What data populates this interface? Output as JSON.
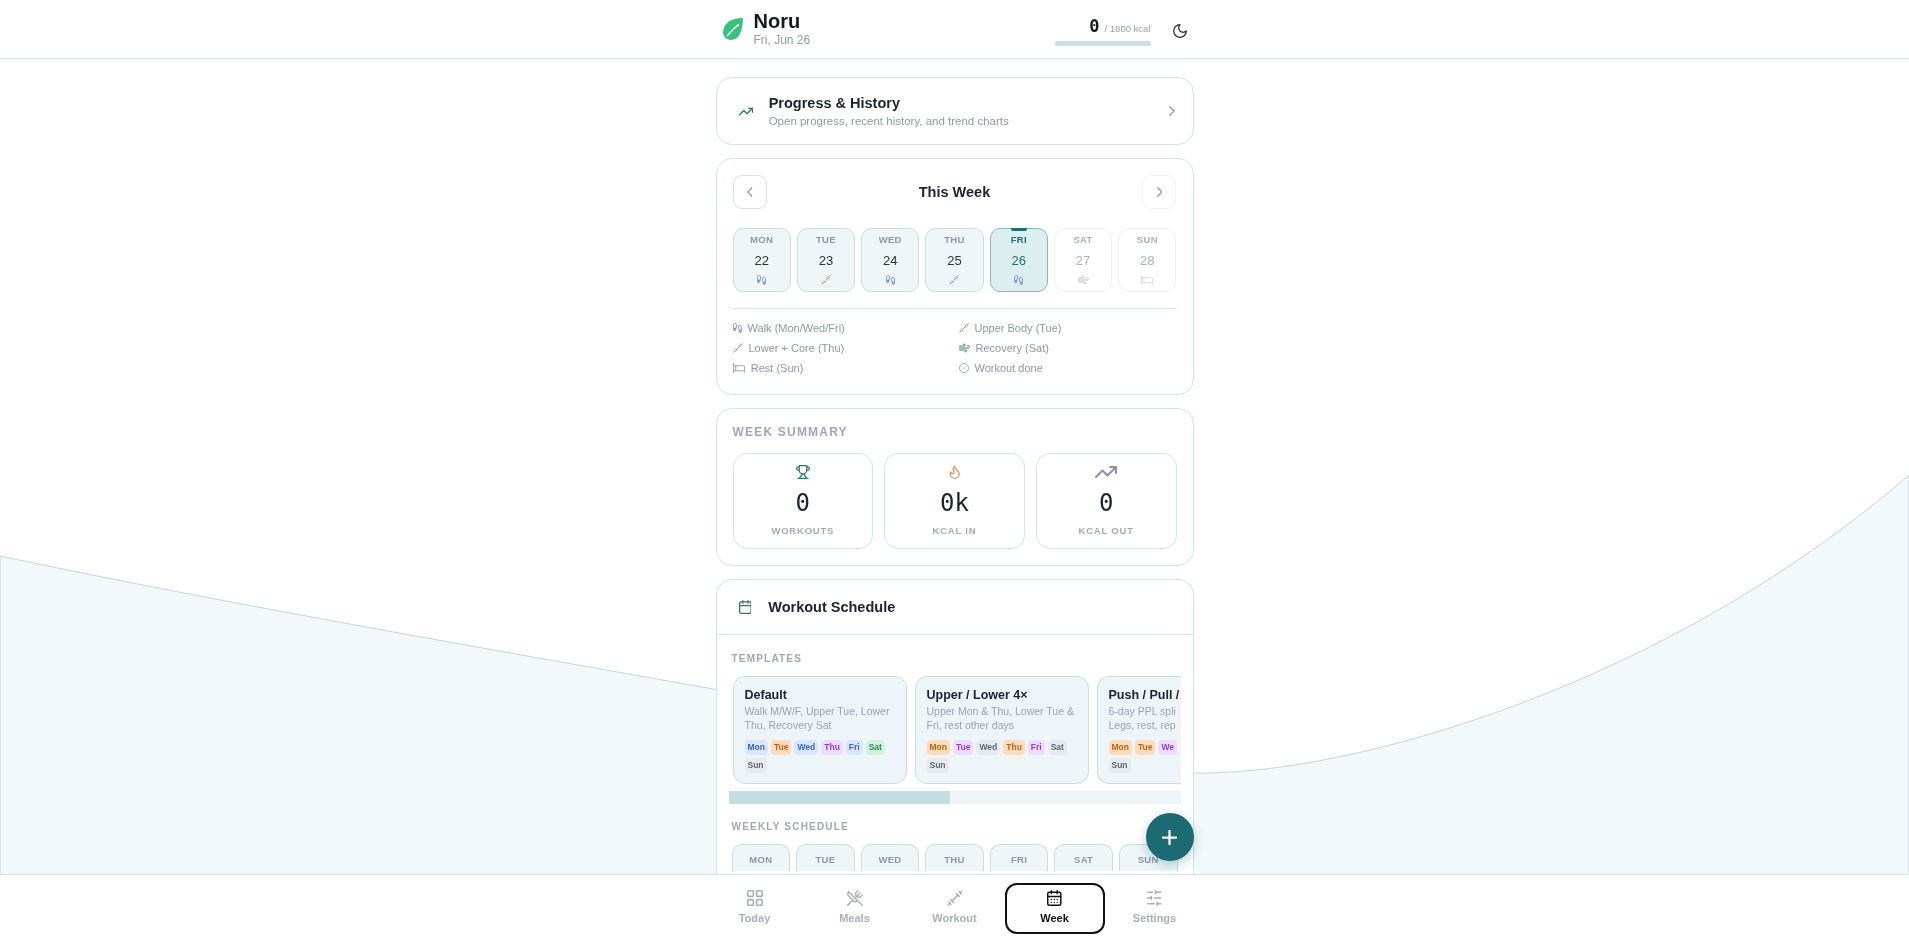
{
  "header": {
    "app_name": "Noru",
    "date": "Fri, Jun 26",
    "calories": {
      "value": "0",
      "goal": "/ 1800 kcal",
      "level": 0
    }
  },
  "progress_card": {
    "title": "Progress & History",
    "subtitle": "Open progress, recent history, and trend charts"
  },
  "week": {
    "title": "This Week",
    "prev": {
      "disabled": false
    },
    "next": {
      "disabled": true
    },
    "days": [
      {
        "name": "MON",
        "date": "22",
        "kind": "walk",
        "selected": false,
        "disabled": false
      },
      {
        "name": "TUE",
        "date": "23",
        "kind": "upper",
        "selected": false,
        "disabled": false
      },
      {
        "name": "WED",
        "date": "24",
        "kind": "walk",
        "selected": false,
        "disabled": false
      },
      {
        "name": "THU",
        "date": "25",
        "kind": "lower",
        "selected": false,
        "disabled": false
      },
      {
        "name": "FRI",
        "date": "26",
        "kind": "walk",
        "selected": true,
        "disabled": false
      },
      {
        "name": "SAT",
        "date": "27",
        "kind": "recovery",
        "selected": false,
        "disabled": true
      },
      {
        "name": "SUN",
        "date": "28",
        "kind": "rest",
        "selected": false,
        "disabled": true
      }
    ],
    "legend": [
      {
        "kind": "walk",
        "label": "Walk (Mon/Wed/Fri)"
      },
      {
        "kind": "upper",
        "label": "Upper Body (Tue)"
      },
      {
        "kind": "lower",
        "label": "Lower + Core (Thu)"
      },
      {
        "kind": "recovery",
        "label": "Recovery (Sat)"
      },
      {
        "kind": "rest",
        "label": "Rest (Sun)"
      },
      {
        "kind": "done",
        "label": "Workout done"
      }
    ]
  },
  "summary": {
    "title": "WEEK SUMMARY",
    "stats": [
      {
        "kind": "workouts",
        "value": "0",
        "label": "WORKOUTS"
      },
      {
        "kind": "kcal_in",
        "value": "0k",
        "label": "KCAL IN"
      },
      {
        "kind": "kcal_out",
        "value": "0",
        "label": "KCAL OUT"
      }
    ]
  },
  "schedule": {
    "title": "Workout Schedule",
    "templates_label": "TEMPLATES",
    "templates": [
      {
        "name": "Default",
        "description": "Walk M/W/F, Upper Tue, Lower\nThu, Recovery Sat",
        "days": [
          {
            "label": "Mon",
            "kind": "walk"
          },
          {
            "label": "Tue",
            "kind": "upper"
          },
          {
            "label": "Wed",
            "kind": "walk"
          },
          {
            "label": "Thu",
            "kind": "lower"
          },
          {
            "label": "Fri",
            "kind": "walk"
          },
          {
            "label": "Sat",
            "kind": "recovery"
          },
          {
            "label": "Sun",
            "kind": "rest"
          }
        ]
      },
      {
        "name": "Upper / Lower 4×",
        "description": "Upper Mon & Thu, Lower Tue &\nFri, rest other days",
        "days": [
          {
            "label": "Mon",
            "kind": "upper"
          },
          {
            "label": "Tue",
            "kind": "lower"
          },
          {
            "label": "Wed",
            "kind": "rest"
          },
          {
            "label": "Thu",
            "kind": "upper"
          },
          {
            "label": "Fri",
            "kind": "lower"
          },
          {
            "label": "Sat",
            "kind": "rest"
          },
          {
            "label": "Sun",
            "kind": "rest"
          }
        ]
      },
      {
        "name": "Push / Pull /",
        "description": "6-day PPL spli\nLegs, rest, rep",
        "days": [
          {
            "label": "Mon",
            "kind": "upper"
          },
          {
            "label": "Tue",
            "kind": "upper"
          },
          {
            "label": "We",
            "kind": "lower"
          },
          {
            "label": "Sun",
            "kind": "rest"
          }
        ]
      }
    ],
    "weekly_label": "WEEKLY SCHEDULE",
    "weekly_days": [
      "MON",
      "TUE",
      "WED",
      "THU",
      "FRI",
      "SAT",
      "SUN"
    ]
  },
  "nav": [
    {
      "label": "Today",
      "kind": "today",
      "selected": false
    },
    {
      "label": "Meals",
      "kind": "meals",
      "selected": false
    },
    {
      "label": "Workout",
      "kind": "workout",
      "selected": false
    },
    {
      "label": "Week",
      "kind": "week",
      "selected": true
    },
    {
      "label": "Settings",
      "kind": "settings",
      "selected": false
    }
  ]
}
